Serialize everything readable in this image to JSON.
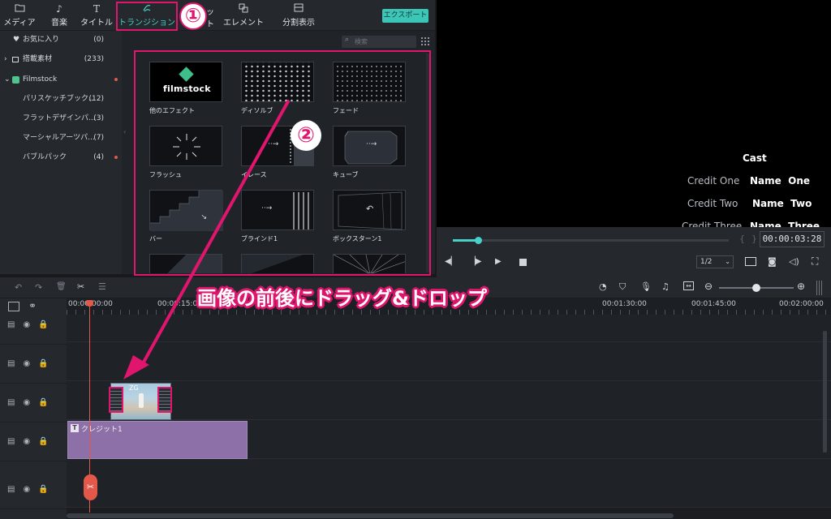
{
  "toolbar": {
    "tabs": [
      {
        "label": "メディア",
        "icon": "folder-icon"
      },
      {
        "label": "音楽",
        "icon": "music-note-icon"
      },
      {
        "label": "タイトル",
        "icon": "text-icon"
      },
      {
        "label": "トランジション",
        "icon": "transition-icon",
        "active": true
      },
      {
        "label": "ット",
        "icon": "effect-icon"
      },
      {
        "label": "エレメント",
        "icon": "element-icon"
      },
      {
        "label": "分割表示",
        "icon": "split-screen-icon"
      }
    ],
    "export_label": "エクスポート"
  },
  "sidebar": {
    "items": [
      {
        "label": "お気に入り",
        "count": "(0)",
        "icon": "heart-icon"
      },
      {
        "label": "搭載素材",
        "count": "(233)",
        "icon": "grid-icon"
      },
      {
        "label": "Filmstock",
        "count": "",
        "icon": "filmstock-icon"
      },
      {
        "label": "パリスケッチブック...",
        "count": "(12)"
      },
      {
        "label": "フラットデザインパ...",
        "count": "(3)"
      },
      {
        "label": "マーシャルアーツパ...",
        "count": "(7)"
      },
      {
        "label": "バブルパック",
        "count": "(4)"
      }
    ]
  },
  "search": {
    "placeholder": "検索"
  },
  "transitions": [
    {
      "label": "他のエフェクト",
      "thumb_text": "filmstock"
    },
    {
      "label": "ディソルブ"
    },
    {
      "label": "フェード"
    },
    {
      "label": "フラッシュ"
    },
    {
      "label": "イレース"
    },
    {
      "label": "キューブ"
    },
    {
      "label": "バー"
    },
    {
      "label": "ブラインド1"
    },
    {
      "label": "ボックスターン1"
    }
  ],
  "preview": {
    "cast": "Cast",
    "credits": [
      {
        "role": "Credit One",
        "name": "Name  One"
      },
      {
        "role": "Credit Two",
        "name": "Name  Two"
      },
      {
        "role": "Credit Three",
        "name": "Name  Three"
      }
    ]
  },
  "player": {
    "timecode": "00:00:03:28",
    "quality": "1/2",
    "progress": 0.09
  },
  "timeline": {
    "ruler": [
      "00:00:00:00",
      "00:00:15:00",
      "00:01:30:00",
      "00:01:45:00",
      "00:02:00:00"
    ],
    "title_clip": "クレジット1",
    "image_clip": "ZG"
  },
  "annotations": {
    "step1": "①",
    "step2": "②",
    "instruction": "画像の前後にドラッグ&ドロップ"
  },
  "colors": {
    "accent": "#47d1c8",
    "highlight": "#e0156e",
    "title_clip": "#8e70a8",
    "playhead": "#e4584a"
  }
}
